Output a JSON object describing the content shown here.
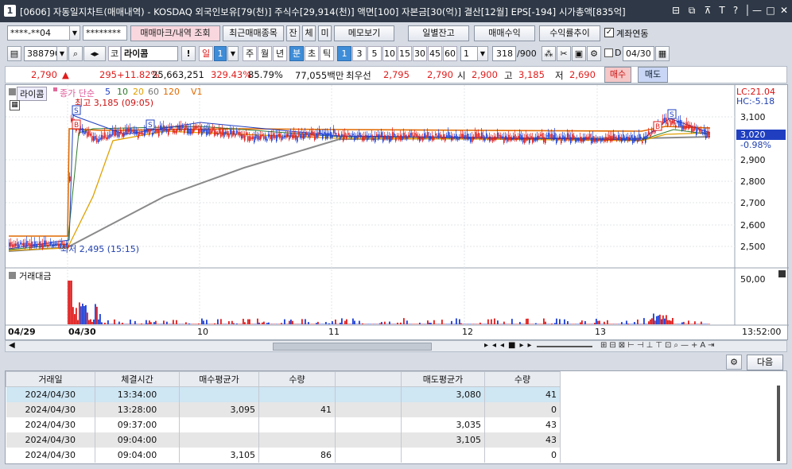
{
  "window": {
    "number": "1",
    "title": "[0606] 자동일지차트(매매내역) - KOSDAQ 외국인보유[79(천)] 주식수[29,914(천)] 액면[100] 자본금[30(억)] 결산[12월] EPS[-194] 시가총액[835억]",
    "controls": [
      "⊟",
      "⧉",
      "⊼",
      "T",
      "?",
      "│",
      "—",
      "□",
      "✕"
    ]
  },
  "toolbar1": {
    "account": "****-**04",
    "password": "********",
    "btn_mark": "매매마크/내역 조회",
    "btn_recent": "최근매매종목",
    "small": [
      "잔",
      "체",
      "미"
    ],
    "btn_memo": "메모보기",
    "btn_daily": "일별잔고",
    "btn_profit": "매매수익",
    "btn_trend": "수익률추이",
    "chk_label": "계좌연동",
    "chk_checked": true
  },
  "toolbar2": {
    "code": "388790",
    "market": "코",
    "name": "라이콤",
    "period_unit": "일",
    "period_num": "1",
    "periods": [
      "주",
      "월",
      "년",
      "분",
      "초",
      "틱"
    ],
    "active_period": "분",
    "intervals": [
      "1",
      "3",
      "5",
      "10",
      "15",
      "30",
      "45",
      "60"
    ],
    "active_interval": "1",
    "count_sel": "1",
    "count": "318",
    "total": "/900",
    "date": "04/30"
  },
  "quote": {
    "price": "2,790",
    "arrow": "▲",
    "change": "295",
    "rate": "+11.82%",
    "volume": "25,663,251",
    "vol_rate": "329.43%",
    "ratio": "85.79%",
    "amount": "77,055백만",
    "best_label": "최우선",
    "ask": "2,795",
    "bid": "2,790",
    "open_label": "시",
    "open": "2,900",
    "high_label": "고",
    "high": "3,185",
    "low_label": "저",
    "low": "2,690",
    "buy_btn": "매수",
    "sell_btn": "매도"
  },
  "chart": {
    "stock_tag": "라이콤",
    "legend_price": "종가 단순",
    "ma": [
      "5",
      "10",
      "20",
      "60",
      "120"
    ],
    "ma_colors": [
      "#1f3fc0",
      "#2d7a2d",
      "#e0a000",
      "#8a8a8a",
      "#e06a00"
    ],
    "v1": "V1",
    "high_note": "최고 3,185 (09:05)",
    "low_note": "최저 2,495 (15:15)",
    "lc": "LC:21.04",
    "hc": "HC:-5.18",
    "price_ticks": [
      "3,100",
      "3,000",
      "2,900",
      "2,800",
      "2,700",
      "2,600",
      "2,500"
    ],
    "current_price": "3,020",
    "current_pct": "-0.98%",
    "volume_label": "거래대금",
    "volume_tick": "50,00",
    "x_labels": [
      "04/29",
      "04/30",
      "10",
      "11",
      "12",
      "13"
    ],
    "time_label": "13:52:00",
    "marks": [
      "S",
      "B",
      "S",
      "B",
      "S"
    ]
  },
  "bottom_controls": {
    "next": "다음"
  },
  "table": {
    "headers": [
      "거래일",
      "체결시간",
      "매수평균가",
      "수량",
      "",
      "매도평균가",
      "수량"
    ],
    "rows": [
      [
        "2024/04/30",
        "13:34:00",
        "",
        "",
        "",
        "3,080",
        "41"
      ],
      [
        "2024/04/30",
        "13:28:00",
        "3,095",
        "41",
        "",
        "",
        "0"
      ],
      [
        "2024/04/30",
        "09:37:00",
        "",
        "",
        "",
        "3,035",
        "43"
      ],
      [
        "2024/04/30",
        "09:04:00",
        "",
        "",
        "",
        "3,105",
        "43"
      ],
      [
        "2024/04/30",
        "09:04:00",
        "3,105",
        "86",
        "",
        "",
        "0"
      ]
    ]
  }
}
